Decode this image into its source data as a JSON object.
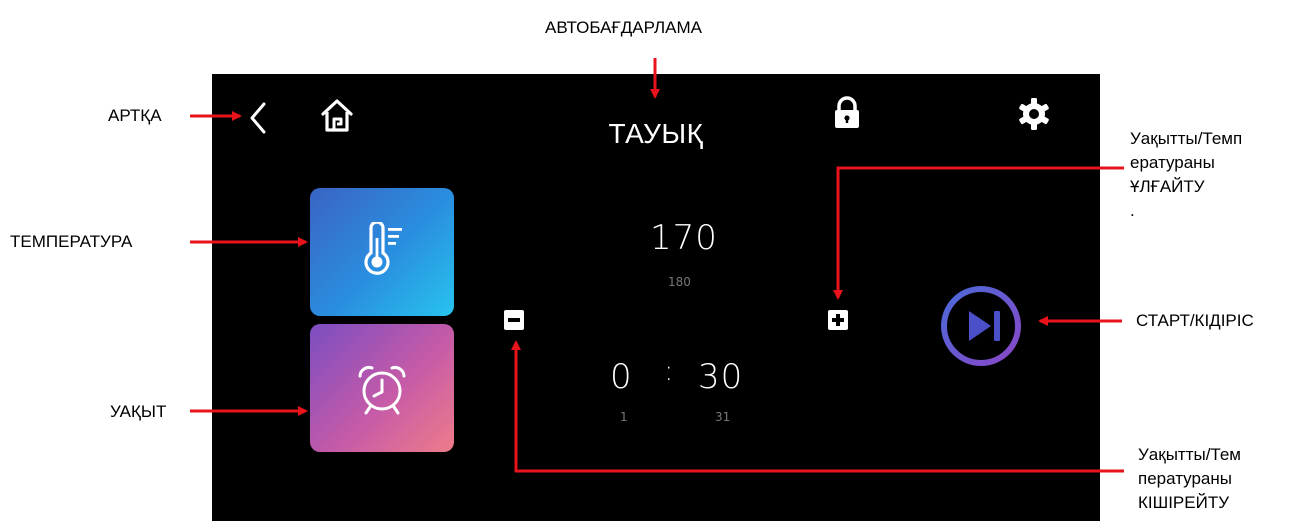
{
  "callouts": {
    "autoprogram": "АВТОБАҒДАРЛАМА",
    "back": "АРТҚА",
    "temperature": "ТЕМПЕРАТУРА",
    "time": "УАҚЫТ",
    "increase": "Уақытты/Темп\nератураны\nҰЛҒАЙТУ\n.",
    "start_pause": "СТАРТ/КІДІРІС",
    "decrease": "Уақытты/Тем\nпературaны\nКІШІРЕЙТУ"
  },
  "screen": {
    "title": "ТАУЫҚ",
    "temperature_value": "170",
    "temperature_sub": "180",
    "time_hours": "0",
    "time_separator": ":",
    "time_minutes": "30",
    "time_hours_sub": "1",
    "time_minutes_sub": "31"
  },
  "icons": {
    "back": "chevron-left-icon",
    "home": "home-icon",
    "lock": "lock-icon",
    "settings": "gear-icon",
    "thermometer": "thermometer-icon",
    "alarm": "alarm-clock-icon",
    "minus": "minus-icon",
    "plus": "plus-icon",
    "play_pause": "play-pause-icon"
  },
  "colors": {
    "arrow": "#e8131b",
    "screen_bg": "#000000",
    "temp_tile": "#2a8fe0",
    "time_tile": "#c55aa8",
    "start_ring": "#5b57c9"
  }
}
